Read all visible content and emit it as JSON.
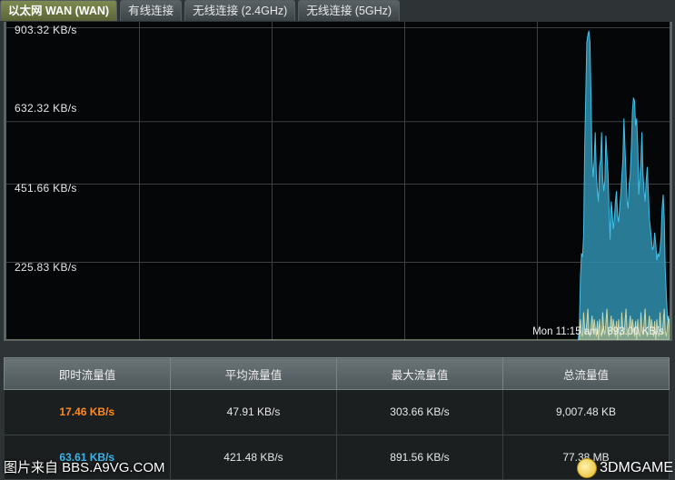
{
  "tabs": [
    {
      "label": "以太网 WAN (WAN)",
      "active": true
    },
    {
      "label": "有线连接",
      "active": false
    },
    {
      "label": "无线连接 (2.4GHz)",
      "active": false
    },
    {
      "label": "无线连接 (5GHz)",
      "active": false
    }
  ],
  "graph": {
    "y_labels": [
      "903.32 KB/s",
      "632.32 KB/s",
      "451.66 KB/s",
      "225.83 KB/s"
    ],
    "stamp": "Mon 11:15 am / 893.00 KB/s",
    "colors": {
      "tx_fill": "#2f8fae",
      "tx_stroke": "#3fc0e8",
      "rx_fill": "#a9b88a",
      "rx_stroke": "#c9d6a6",
      "grid": "#3c4042"
    }
  },
  "chart_data": {
    "type": "area",
    "ylim": [
      0,
      903.32
    ],
    "y_ticks": [
      903.32,
      632.32,
      451.66,
      225.83
    ],
    "y_unit": "KB/s",
    "series": [
      {
        "values": [
          0,
          0,
          0,
          0,
          0,
          0,
          0,
          0,
          0,
          0,
          0,
          0,
          0,
          0,
          0,
          0,
          0,
          0,
          0,
          0,
          0,
          0,
          0,
          0,
          0,
          0,
          0,
          0,
          0,
          0,
          0,
          0,
          0,
          0,
          0,
          0,
          0,
          0,
          0,
          0,
          0,
          0,
          0,
          0,
          0,
          0,
          0,
          0,
          0,
          0,
          0,
          0,
          0,
          0,
          0,
          0,
          0,
          0,
          0,
          0,
          0,
          0,
          0,
          0,
          0,
          0,
          0,
          0,
          0,
          0,
          0,
          0,
          0,
          0,
          0,
          0,
          0,
          0,
          0,
          0,
          0,
          0,
          0,
          0,
          0,
          0,
          0,
          0,
          0,
          0,
          0,
          0,
          0,
          0,
          0,
          0,
          0,
          0,
          0,
          0,
          0,
          0,
          0,
          0,
          0,
          0,
          0,
          0,
          0,
          0,
          0,
          0,
          0,
          0,
          0,
          0,
          0,
          0,
          0,
          0,
          0,
          0,
          0,
          0,
          0,
          0,
          0,
          0,
          0,
          0,
          0,
          0,
          0,
          0,
          0,
          0,
          0,
          0,
          0,
          0,
          0,
          0,
          0,
          0,
          0,
          0,
          0,
          0,
          0,
          0,
          0,
          0,
          0,
          0,
          0,
          0,
          0,
          0,
          0,
          0,
          0,
          0,
          0,
          0,
          0,
          0,
          0,
          0,
          0,
          0,
          0,
          0,
          0,
          0,
          0,
          0,
          0,
          0,
          0,
          0,
          0,
          0,
          0,
          0,
          0,
          0,
          0,
          0,
          0,
          0,
          0,
          0,
          0,
          0,
          0,
          0,
          0,
          0,
          0,
          0,
          0,
          0,
          0,
          0,
          0,
          0,
          0,
          0,
          0,
          0,
          0,
          0,
          0,
          0,
          0,
          0,
          0,
          0,
          0,
          0,
          0,
          0,
          0,
          0,
          0,
          0,
          0,
          0,
          0,
          0,
          0,
          0,
          0,
          0,
          0,
          0,
          0,
          0,
          0,
          0,
          0,
          0,
          0,
          0,
          0,
          0,
          0,
          0,
          0,
          0,
          0,
          0,
          0,
          0,
          0,
          0,
          0,
          0,
          0,
          0,
          0,
          0,
          0,
          0,
          0,
          0,
          0,
          0,
          0,
          0,
          0,
          0,
          0,
          0,
          0,
          0,
          0,
          0,
          0,
          0,
          0,
          0,
          0,
          0,
          0,
          0,
          0,
          0,
          0,
          0,
          0,
          0,
          0,
          0,
          0,
          0,
          0,
          0,
          0,
          0,
          0,
          0,
          0,
          0,
          0,
          0,
          0,
          0,
          0,
          0,
          0,
          0,
          0,
          0,
          0,
          0,
          0,
          0,
          0,
          0,
          0,
          0,
          0,
          0,
          0,
          0,
          0,
          0,
          0,
          0,
          0,
          0,
          0,
          0,
          0,
          0,
          0,
          0,
          0,
          0,
          0,
          0,
          0,
          0,
          0,
          0,
          0,
          0,
          0,
          0,
          0,
          0,
          0,
          0,
          0,
          0,
          0,
          0,
          0,
          0,
          0,
          0,
          0,
          0,
          0,
          0,
          0,
          0,
          0,
          0,
          0,
          0,
          0,
          0,
          0,
          0,
          0,
          0,
          0,
          0,
          0,
          0,
          0,
          0,
          0,
          0,
          0,
          0,
          0,
          0,
          0,
          0,
          0,
          0,
          0,
          0,
          0,
          0,
          0,
          0,
          0,
          0,
          0,
          0,
          0,
          0,
          0,
          0,
          0,
          0,
          0,
          0,
          0,
          0,
          0,
          0,
          0,
          0,
          0,
          0,
          0,
          0,
          0,
          0,
          0,
          0,
          0,
          0,
          0,
          0,
          0,
          0,
          0,
          0,
          0,
          0,
          0,
          0,
          0,
          0,
          0,
          0,
          0,
          0,
          0,
          0,
          0,
          0,
          0,
          0,
          0,
          0,
          0,
          0,
          0,
          0,
          0,
          0,
          0,
          0,
          0,
          0,
          0,
          0,
          0,
          0,
          0,
          0,
          0,
          0,
          0,
          0,
          0,
          0,
          0,
          0,
          0,
          0,
          0,
          0,
          0,
          0,
          0,
          0,
          0,
          0,
          0,
          0,
          0,
          0,
          0,
          0,
          0,
          0,
          0,
          0,
          0,
          0,
          0,
          0,
          0,
          0,
          0,
          0,
          0,
          0,
          0,
          0,
          0,
          0,
          0,
          0,
          0,
          0,
          0,
          0,
          0,
          0,
          0,
          0,
          0,
          0,
          0,
          0,
          0,
          0,
          0,
          0,
          0,
          0,
          0,
          0,
          0,
          0,
          0,
          0,
          0,
          0,
          0,
          0,
          40,
          180,
          250,
          240,
          300,
          560,
          700,
          860,
          880,
          893,
          860,
          700,
          520,
          470,
          520,
          600,
          480,
          430,
          400,
          500,
          520,
          600,
          470,
          430,
          460,
          590,
          530,
          480,
          380,
          290,
          400,
          370,
          320,
          350,
          400,
          430,
          360,
          340,
          380,
          420,
          470,
          520,
          640,
          560,
          480,
          400,
          380,
          450,
          480,
          560,
          660,
          700,
          690,
          620,
          640,
          560,
          420,
          470,
          520,
          600,
          480,
          430,
          400,
          460,
          500,
          430,
          350,
          320,
          290,
          260,
          270,
          310,
          280,
          230,
          250,
          240,
          260,
          300,
          380,
          420,
          350,
          200,
          130,
          60,
          60,
          60
        ]
      }
    ]
  },
  "stats": {
    "headers": [
      "即时流量值",
      "平均流量值",
      "最大流量值",
      "总流量值"
    ],
    "rows": [
      {
        "cls": "rx",
        "cells": [
          "17.46 KB/s",
          "47.91 KB/s",
          "303.66 KB/s",
          "9,007.48 KB"
        ]
      },
      {
        "cls": "tx",
        "cells": [
          "63.61 KB/s",
          "421.48 KB/s",
          "891.56 KB/s",
          "77.38 MB"
        ]
      }
    ]
  },
  "watermarks": {
    "left": "图片来自 BBS.A9VG.COM",
    "right": "3DMGAME"
  }
}
